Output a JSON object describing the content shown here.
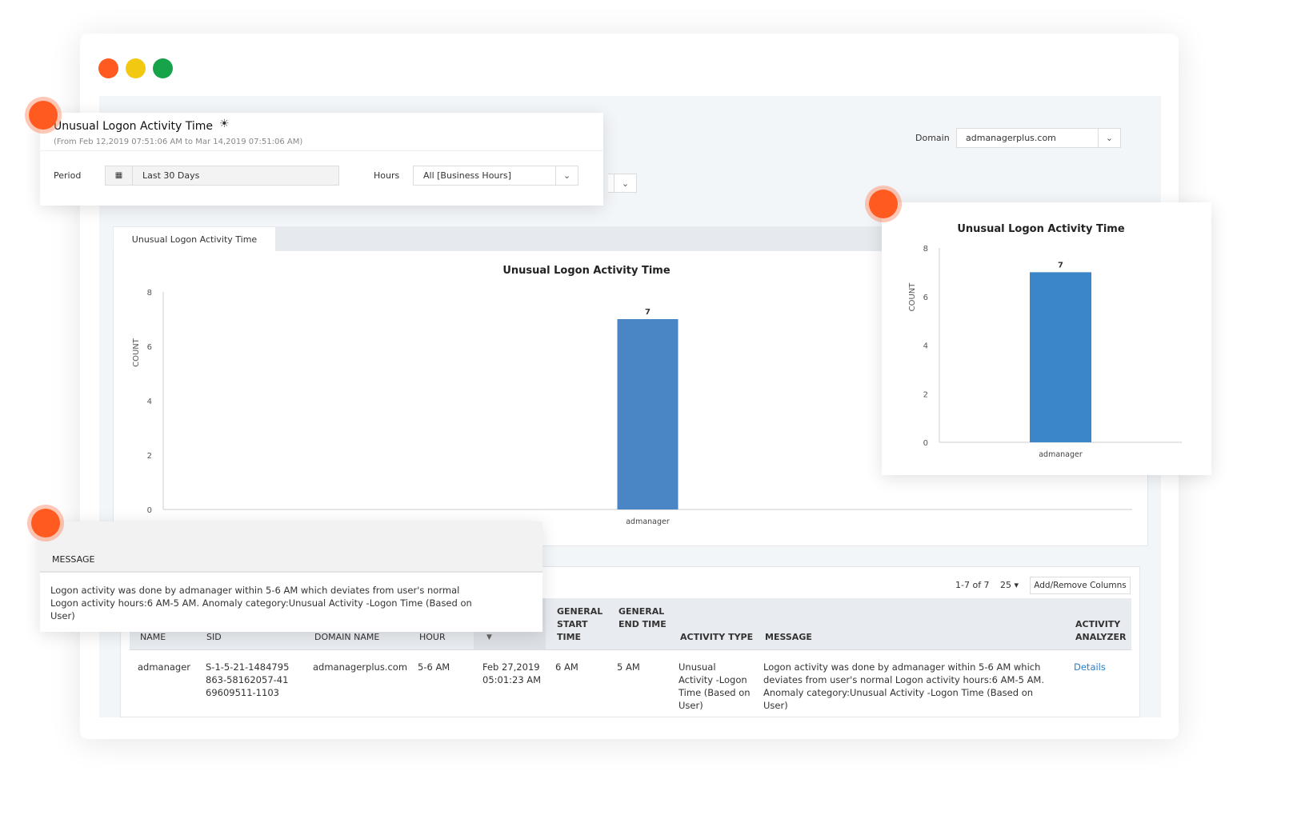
{
  "report": {
    "title": "Unusual Logon Activity Time",
    "range": "(From Feb 12,2019 07:51:06 AM to Mar 14,2019 07:51:06 AM)",
    "period_label": "Period",
    "period_value": "Last 30 Days",
    "hours_label": "Hours",
    "hours_value": "All [Business Hours]"
  },
  "domain": {
    "label": "Domain",
    "value": "admanagerplus.com"
  },
  "tab": {
    "label": "Unusual Logon Activity Time"
  },
  "chart_data": [
    {
      "type": "bar",
      "title": "Unusual Logon Activity Time",
      "ylabel": "COUNT",
      "categories": [
        "admanager"
      ],
      "values": [
        7
      ],
      "ylim": [
        0,
        8
      ],
      "yticks": [
        0,
        2,
        4,
        6,
        8
      ],
      "color": "#4a86c5",
      "data_labels": [
        "7"
      ]
    },
    {
      "type": "bar",
      "title": "Unusual Logon Activity Time",
      "ylabel": "COUNT",
      "categories": [
        "admanager"
      ],
      "values": [
        7
      ],
      "ylim": [
        0,
        8
      ],
      "yticks": [
        0,
        2,
        4,
        6,
        8
      ],
      "color": "#3b86c8",
      "data_labels": [
        "7"
      ]
    }
  ],
  "message_popup": {
    "header": "MESSAGE",
    "text": "Logon activity was done by admanager within 5-6 AM which deviates from user's normal Logon activity hours:6 AM-5 AM. Anomaly category:Unusual Activity -Logon Time (Based on User)"
  },
  "table": {
    "pagination": "1-7 of 7",
    "page_size": "25",
    "add_remove": "Add/Remove Columns",
    "columns": [
      "NAME",
      "SID",
      "DOMAIN NAME",
      "HOUR",
      "",
      "GENERAL START TIME",
      "GENERAL END TIME",
      "ACTIVITY TYPE",
      "MESSAGE",
      "ACTIVITY ANALYZER"
    ],
    "rows": [
      {
        "name": "admanager",
        "sid": "S-1-5-21-1484795863-58162057-4169609511-1103",
        "domain": "admanagerplus.com",
        "hour": "5-6 AM",
        "time": "Feb 27,2019 05:01:23 AM",
        "start": "6 AM",
        "end": "5 AM",
        "type": "Unusual Activity -Logon Time (Based on User)",
        "message": "Logon activity was done by admanager within 5-6 AM which deviates from user's normal Logon activity hours:6 AM-5 AM. Anomaly category:Unusual Activity -Logon Time (Based on User)",
        "link": "Details"
      }
    ]
  },
  "colors": {
    "close": "#ff5a1f",
    "minimize": "#f2c811",
    "maximize": "#17a34a",
    "accent": "#2a7fc9",
    "marker": "#ff5a1f"
  }
}
